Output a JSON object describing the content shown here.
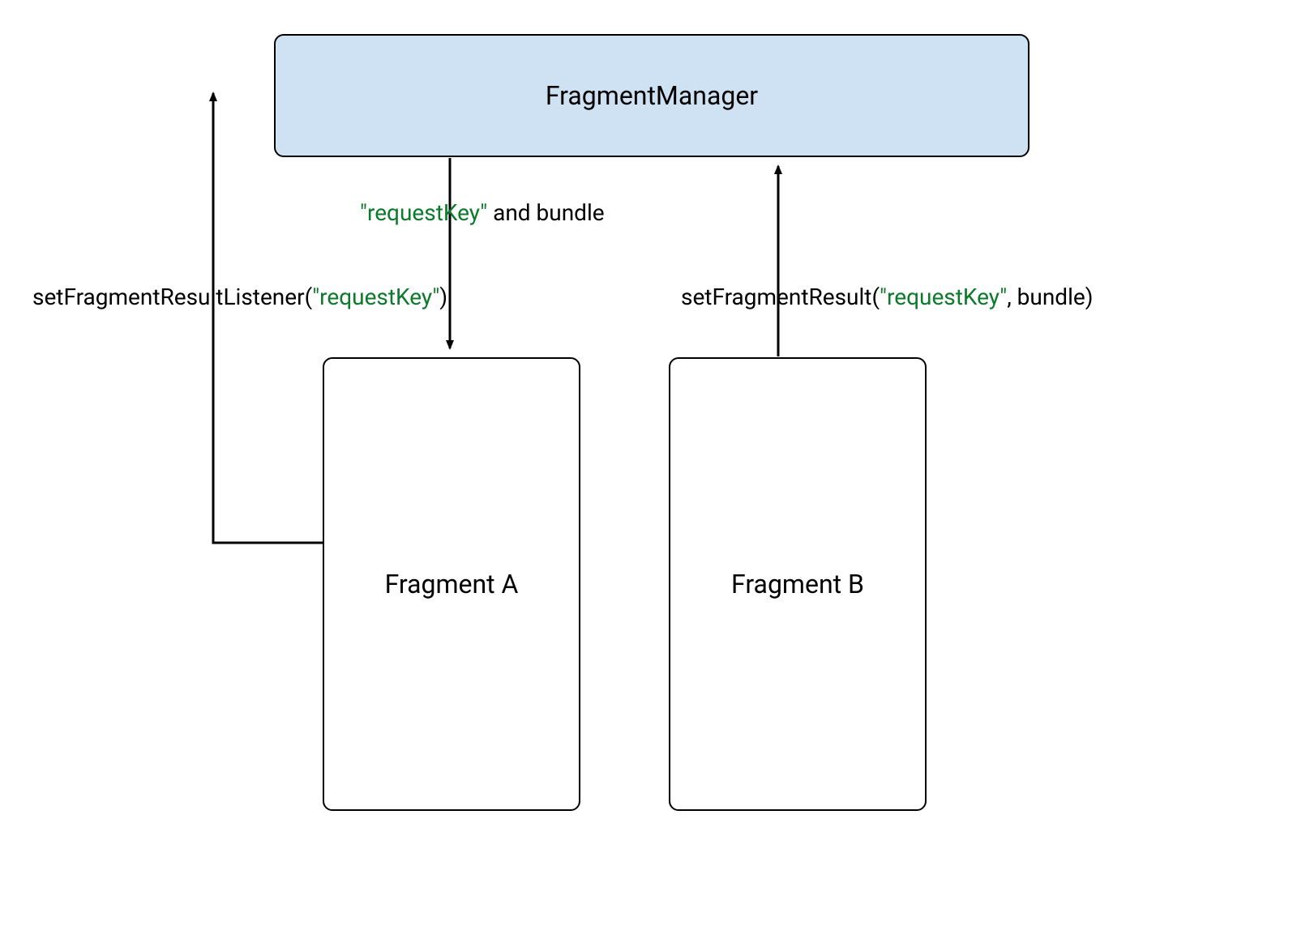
{
  "boxes": {
    "manager": "FragmentManager",
    "fragmentA": "Fragment A",
    "fragmentB": "Fragment B"
  },
  "labels": {
    "listener_pre": "setFragmentResultListener(",
    "listener_key": "\"requestKey\"",
    "listener_post": ")",
    "mid_key": "\"requestKey\"",
    "mid_post": " and bundle",
    "result_pre": "setFragmentResult(",
    "result_key": "\"requestKey\"",
    "result_post": ", bundle)"
  },
  "colors": {
    "managerFill": "#cfe2f3",
    "stroke": "#000000",
    "keyString": "#0b7a2b"
  }
}
